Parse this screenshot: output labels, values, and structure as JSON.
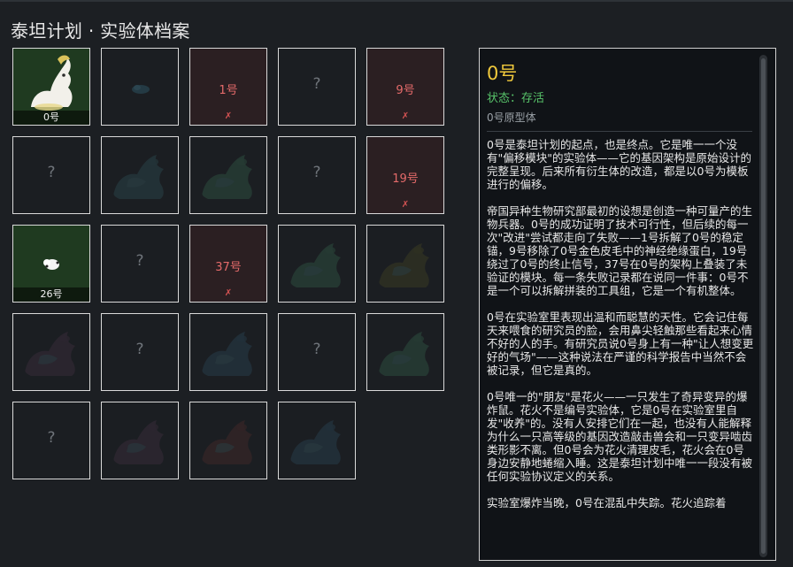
{
  "page": {
    "title": "泰坦计划 · 实验体档案"
  },
  "grid": {
    "cells": [
      {
        "kind": "alive",
        "label": "0号",
        "icon": "white-creature-icon"
      },
      {
        "kind": "silhouette",
        "icon": "small-creature-silhouette-icon"
      },
      {
        "kind": "failed",
        "label": "1号",
        "mark": "✗"
      },
      {
        "kind": "unknown",
        "text": "?"
      },
      {
        "kind": "failed",
        "label": "9号",
        "mark": "✗"
      },
      {
        "kind": "unknown",
        "text": "?"
      },
      {
        "kind": "silhouette",
        "icon": "beast-silhouette-icon"
      },
      {
        "kind": "silhouette",
        "icon": "winged-beast-silhouette-icon"
      },
      {
        "kind": "unknown",
        "text": "?"
      },
      {
        "kind": "failed",
        "label": "19号",
        "mark": "✗"
      },
      {
        "kind": "alive",
        "label": "26号",
        "icon": "small-pet-icon"
      },
      {
        "kind": "unknown",
        "text": "?"
      },
      {
        "kind": "failed",
        "label": "37号",
        "mark": "✗"
      },
      {
        "kind": "silhouette",
        "icon": "crouching-beast-silhouette-icon"
      },
      {
        "kind": "silhouette",
        "icon": "red-beast-silhouette-icon"
      },
      {
        "kind": "silhouette",
        "icon": "crested-beast-silhouette-icon"
      },
      {
        "kind": "unknown",
        "text": "?"
      },
      {
        "kind": "silhouette",
        "icon": "crested-beast-silhouette-icon"
      },
      {
        "kind": "unknown",
        "text": "?"
      },
      {
        "kind": "silhouette",
        "icon": "green-beast-silhouette-icon"
      },
      {
        "kind": "unknown",
        "text": "?"
      },
      {
        "kind": "silhouette",
        "icon": "flame-beast-silhouette-icon"
      },
      {
        "kind": "silhouette",
        "icon": "dark-beast-silhouette-icon"
      },
      {
        "kind": "silhouette",
        "icon": "forest-beast-silhouette-icon"
      }
    ]
  },
  "detail": {
    "name": "0号",
    "status": "状态：存活",
    "subtype": "0号原型体",
    "paragraphs": [
      "0号是泰坦计划的起点，也是终点。它是唯一一个没有\"偏移模块\"的实验体——它的基因架构是原始设计的完整呈现。后来所有衍生体的改造，都是以0号为模板进行的偏移。",
      "帝国异种生物研究部最初的设想是创造一种可量产的生物兵器。0号的成功证明了技术可行性，但后续的每一次\"改进\"尝试都走向了失败——1号拆解了0号的稳定锚，9号移除了0号金色皮毛中的神经绝缘蛋白，19号绕过了0号的终止信号，37号在0号的架构上叠装了未验证的模块。每一条失败记录都在说同一件事：0号不是一个可以拆解拼装的工具组，它是一个有机整体。",
      "0号在实验室里表现出温和而聪慧的天性。它会记住每天来喂食的研究员的脸，会用鼻尖轻触那些看起来心情不好的人的手。有研究员说0号身上有一种\"让人想变更好的气场\"——这种说法在严谨的科学报告中当然不会被记录，但它是真的。",
      "0号唯一的\"朋友\"是花火——一只发生了奇异变异的爆炸鼠。花火不是编号实验体，它是0号在实验室里自发\"收养\"的。没有人安排它们在一起，也没有人能解释为什么一只高等级的基因改造敲击兽会和一只变异啮齿类形影不离。但0号会为花火清理皮毛，花火会在0号身边安静地蜷缩入睡。这是泰坦计划中唯一一段没有被任何实验协议定义的关系。",
      "实验室爆炸当晚，0号在混乱中失踪。花火追踪着"
    ]
  },
  "colors": {
    "accent": "#f0c93c",
    "alive": "#58c46a",
    "failed": "#e46a6a"
  }
}
